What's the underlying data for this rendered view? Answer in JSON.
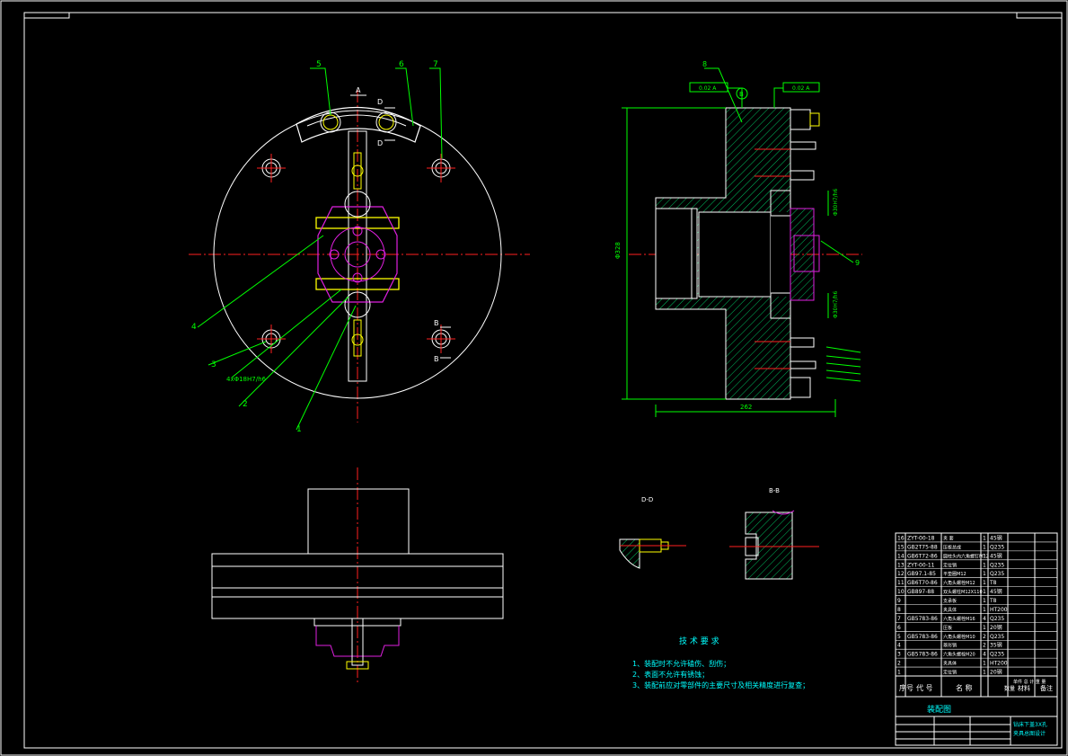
{
  "colors": {
    "background": "#000000",
    "outline": "#ffffff",
    "center": "#ff2020",
    "leader": "#00ff00",
    "hatch": "#00c060",
    "part": "#ffff00",
    "magenta": "#e020e0",
    "cyan": "#00ffff",
    "dim": "#00ff00"
  },
  "front_view": {
    "balloons": [
      "5",
      "6",
      "7",
      "4",
      "3",
      "2",
      "1"
    ],
    "section_marks": {
      "a": "A",
      "d1": "D",
      "d2": "D",
      "b1": "B",
      "b2": "B"
    },
    "note": "4xΦ18H7/h6"
  },
  "side_view": {
    "balloons": [
      "8",
      "9"
    ],
    "datum": "B",
    "tol_left": "0.02 A",
    "tol_right": "0.02 A",
    "dim_height": "Φ328",
    "dim_width": "262",
    "dim_small_top": "Φ30H7/h6",
    "dim_small_bottom": "Φ30H7/h6"
  },
  "sections": {
    "dd_title": "D-D",
    "bb_title": "B-B"
  },
  "tech_req": {
    "title": "技 术 要 求",
    "items": [
      "1、装配时不允许磕伤、刮伤；",
      "2、表面不允许有锈蚀；",
      "3、装配前应对零部件的主要尺寸及相关精度进行复查；"
    ]
  },
  "bom": {
    "rows": [
      {
        "no": "16",
        "code": "ZYT-00-18",
        "name": "夹 套",
        "qty": "1",
        "mat": "45钢"
      },
      {
        "no": "15",
        "code": "GB2T75-88",
        "name": "压板总成",
        "qty": "1",
        "mat": "Q235"
      },
      {
        "no": "14",
        "code": "GB6T72-86",
        "name": "圆柱头内六角螺钉M12",
        "qty": "1",
        "mat": "45钢"
      },
      {
        "no": "13",
        "code": "ZYT-00-11",
        "name": "定位销",
        "qty": "1",
        "mat": "Q235"
      },
      {
        "no": "12",
        "code": "GB97.1-85",
        "name": "平垫圈M12",
        "qty": "1",
        "mat": "Q235"
      },
      {
        "no": "11",
        "code": "GB6T70-86",
        "name": "六角头螺栓M12",
        "qty": "1",
        "mat": "T8"
      },
      {
        "no": "10",
        "code": "GB897-88",
        "name": "双头螺柱M12X110",
        "qty": "1",
        "mat": "45钢"
      },
      {
        "no": "9",
        "code": "",
        "name": "支承板",
        "qty": "1",
        "mat": "T8"
      },
      {
        "no": "8",
        "code": "",
        "name": "夹具体",
        "qty": "1",
        "mat": "HT200"
      },
      {
        "no": "7",
        "code": "GB5783-86",
        "name": "六角头螺栓M16",
        "qty": "4",
        "mat": "Q235"
      },
      {
        "no": "6",
        "code": "",
        "name": "压板",
        "qty": "1",
        "mat": "20钢"
      },
      {
        "no": "5",
        "code": "GB5783-86",
        "name": "六角头螺栓M10",
        "qty": "2",
        "mat": "Q235"
      },
      {
        "no": "4",
        "code": "",
        "name": "菱形销",
        "qty": "2",
        "mat": "35钢"
      },
      {
        "no": "3",
        "code": "GB5783-86",
        "name": "六角头螺栓M20",
        "qty": "4",
        "mat": "Q235"
      },
      {
        "no": "2",
        "code": "",
        "name": "夹具体",
        "qty": "1",
        "mat": "HT200"
      },
      {
        "no": "1",
        "code": "",
        "name": "定位销",
        "qty": "1",
        "mat": "20钢"
      }
    ],
    "header": {
      "no": "序号",
      "code": "代 号",
      "name": "名 称",
      "qty": "数量",
      "mat": "材料",
      "weight": "单件 总 计 重 量",
      "remark": "备注"
    },
    "title": "装配图",
    "project_line1": "钻床下盖3X孔",
    "project_line2": "夹具总图设计"
  }
}
